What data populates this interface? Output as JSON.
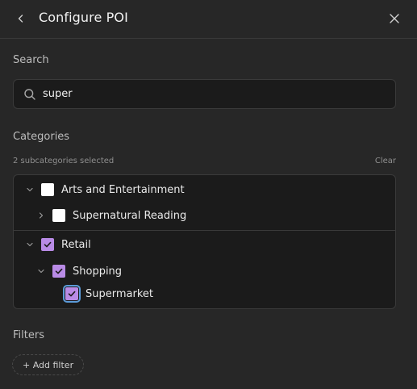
{
  "header": {
    "title": "Configure POI",
    "back_icon": "chevron-left-icon",
    "close_icon": "close-icon"
  },
  "search": {
    "label": "Search",
    "value": "super",
    "icon": "search-icon"
  },
  "categories": {
    "label": "Categories",
    "selected_text": "2 subcategories selected",
    "clear_label": "Clear",
    "accent_color": "#b98be6",
    "tree": [
      {
        "label": "Arts and Entertainment",
        "checked": false,
        "expanded": true
      },
      {
        "label": "Supernatural Reading",
        "checked": false,
        "expanded": false
      },
      {
        "label": "Retail",
        "checked": true,
        "expanded": true
      },
      {
        "label": "Shopping",
        "checked": true,
        "expanded": true
      },
      {
        "label": "Supermarket",
        "checked": true,
        "focused": true
      }
    ]
  },
  "filters": {
    "label": "Filters",
    "add_label": "+ Add filter"
  }
}
